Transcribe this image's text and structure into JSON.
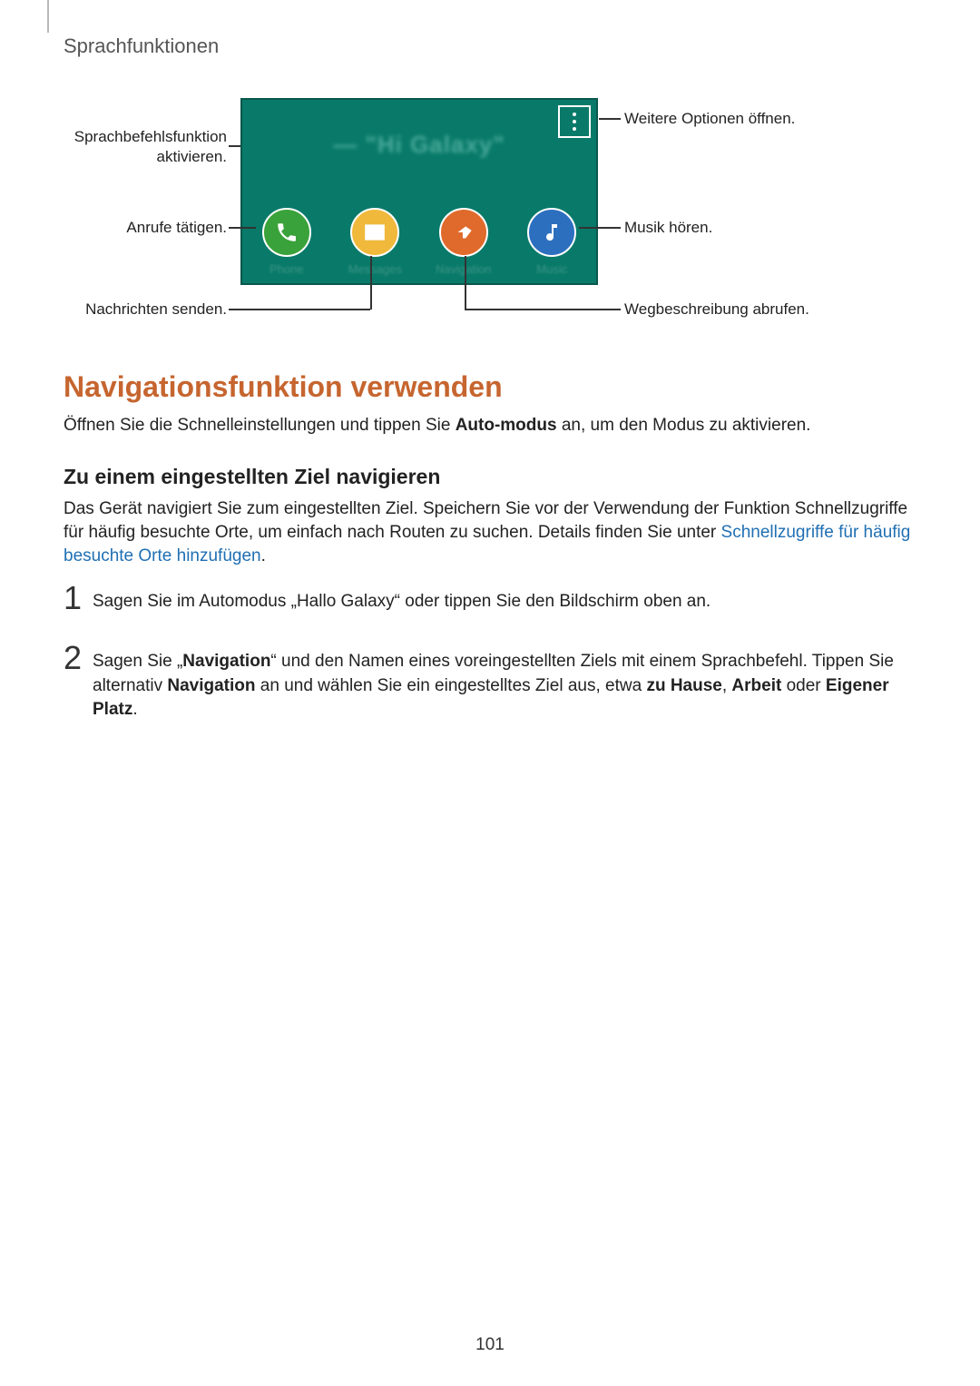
{
  "breadcrumb": "Sprachfunktionen",
  "figure": {
    "hint": "— \"Hi Galaxy\"",
    "menu_name": "menu",
    "apps": {
      "phone": "Phone",
      "messages": "Messages",
      "navigation": "Navigation",
      "music": "Music"
    },
    "callouts": {
      "voice_activate": "Sprachbefehlsfunktion aktivieren.",
      "more_options": "Weitere Optionen öffnen.",
      "make_calls": "Anrufe tätigen.",
      "listen_music": "Musik hören.",
      "send_messages": "Nachrichten senden.",
      "get_directions": "Wegbeschreibung abrufen."
    }
  },
  "h1": "Navigationsfunktion verwenden",
  "p1_pre": "Öffnen Sie die Schnelleinstellungen und tippen Sie ",
  "p1_bold": "Auto-modus",
  "p1_post": " an, um den Modus zu aktivieren.",
  "h2": "Zu einem eingestellten Ziel navigieren",
  "p2_pre": "Das Gerät navigiert Sie zum eingestellten Ziel. Speichern Sie vor der Verwendung der Funktion Schnellzugriffe für häufig besuchte Orte, um einfach nach Routen zu suchen. Details finden Sie unter ",
  "p2_link": "Schnellzugriffe für häufig besuchte Orte hinzufügen",
  "p2_post": ".",
  "step1": {
    "num": "1",
    "text": "Sagen Sie im Automodus „Hallo Galaxy“ oder tippen Sie den Bildschirm oben an."
  },
  "step2": {
    "num": "2",
    "a": "Sagen Sie „",
    "b": "Navigation",
    "c": "“ und den Namen eines voreingestellten Ziels mit einem Sprachbefehl. Tippen Sie alternativ ",
    "d": "Navigation",
    "e": " an und wählen Sie ein eingestelltes Ziel aus, etwa ",
    "f": "zu Hause",
    "g": ", ",
    "h": "Arbeit",
    "i": " oder ",
    "j": "Eigener Platz",
    "k": "."
  },
  "page_no": "101"
}
